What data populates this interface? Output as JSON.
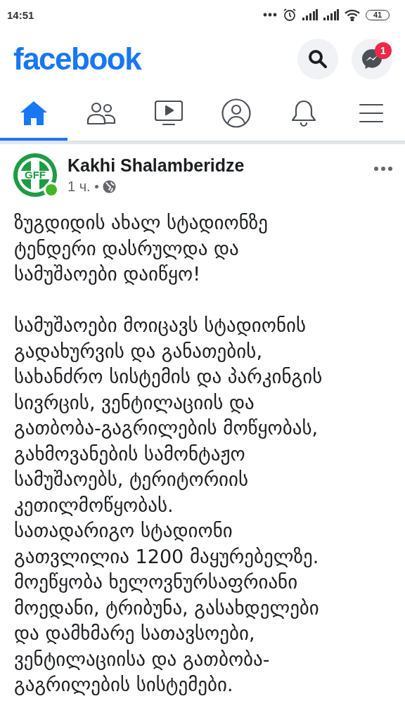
{
  "status_bar": {
    "time": "14:51",
    "battery": "41"
  },
  "header": {
    "logo": "facebook",
    "messenger_badge": "1"
  },
  "tabs": [
    {
      "kind": "home",
      "selected": true
    },
    {
      "kind": "friends",
      "selected": false
    },
    {
      "kind": "video",
      "selected": false
    },
    {
      "kind": "profile",
      "selected": false
    },
    {
      "kind": "bell",
      "selected": false
    },
    {
      "kind": "menu",
      "selected": false
    }
  ],
  "post": {
    "author": "Kakhi Shalamberidze",
    "online": true,
    "time": "1 ч.",
    "avatar_text": "GFF",
    "paragraphs": [
      [
        "ზუგდიდის ახალ სტადიონზე",
        "ტენდერი დასრულდა და",
        "სამუშაოები დაიწყო!"
      ],
      [
        "სამუშაოები მოიცავს სტადიონის",
        "გადახურვის და განათების,",
        "სახანძრო სისტემის და პარკინგის",
        "სივრცის, ვენტილაციის და",
        "გათბობა-გაგრილების მოწყობას,",
        "გახმოვანების სამონტაჟო",
        "სამუშაოებს, ტერიტორიის",
        "კეთილმოწყობას.",
        "სათადარიგო სტადიონი",
        "გათვლილია 1200 მაყურებელზე.",
        "მოეწყობა ხელოვნურსაფრიანი",
        "მოედანი, ტრიბუნა, გასახდელები",
        "და დამხმარე სათავსოები,",
        "ვენტილაციისა და გათბობა-",
        "გაგრილების სისტემები."
      ]
    ]
  }
}
